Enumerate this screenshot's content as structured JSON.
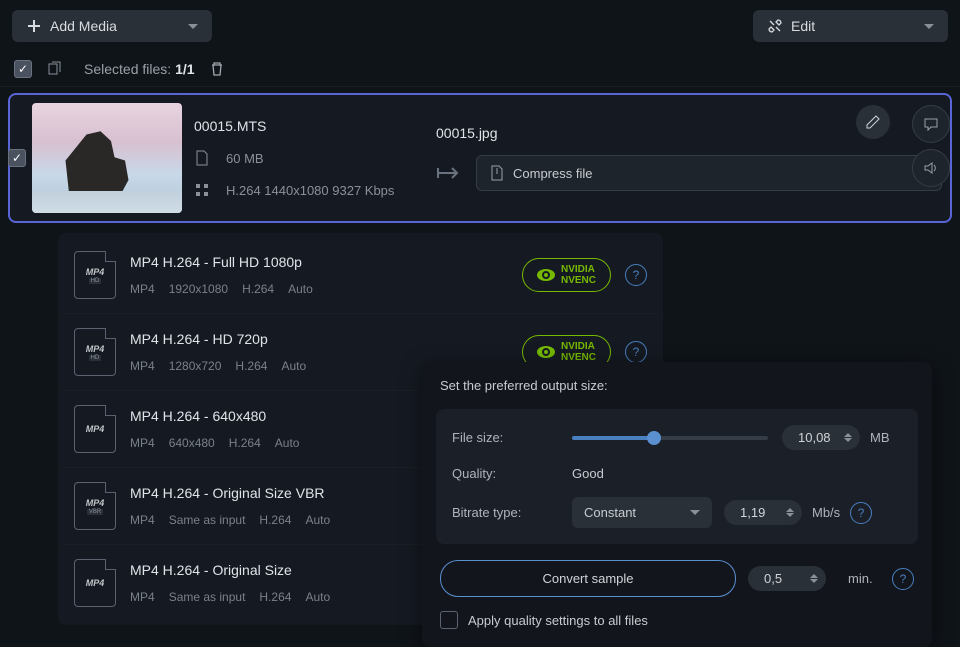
{
  "topbar": {
    "add_media_label": "Add Media",
    "edit_label": "Edit"
  },
  "selection": {
    "label_prefix": "Selected files:",
    "count": "1/1"
  },
  "file": {
    "source_name": "00015.MTS",
    "size": "60 MB",
    "specs": "H.264 1440x1080 9327 Kbps",
    "output_name": "00015.jpg",
    "compress_label": "Compress file"
  },
  "presets": [
    {
      "title": "MP4 H.264 - Full HD 1080p",
      "fmt": "MP4",
      "res": "1920x1080",
      "codec": "H.264",
      "rate": "Auto",
      "badge": true,
      "sub": "HD"
    },
    {
      "title": "MP4 H.264 - HD 720p",
      "fmt": "MP4",
      "res": "1280x720",
      "codec": "H.264",
      "rate": "Auto",
      "badge": true,
      "sub": "HD"
    },
    {
      "title": "MP4 H.264 - 640x480",
      "fmt": "MP4",
      "res": "640x480",
      "codec": "H.264",
      "rate": "Auto",
      "badge": false,
      "sub": ""
    },
    {
      "title": "MP4 H.264 - Original Size VBR",
      "fmt": "MP4",
      "res": "Same as input",
      "codec": "H.264",
      "rate": "Auto",
      "badge": false,
      "sub": "VBR"
    },
    {
      "title": "MP4 H.264 - Original Size",
      "fmt": "MP4",
      "res": "Same as input",
      "codec": "H.264",
      "rate": "Auto",
      "badge": false,
      "sub": ""
    }
  ],
  "nvidia": {
    "line1": "NVIDIA",
    "line2": "NVENC"
  },
  "panel": {
    "title": "Set the preferred output size:",
    "filesize_label": "File size:",
    "filesize_value": "10,08",
    "filesize_unit": "MB",
    "quality_label": "Quality:",
    "quality_value": "Good",
    "bitrate_label": "Bitrate type:",
    "bitrate_value": "Constant",
    "bitrate_num": "1,19",
    "bitrate_unit": "Mb/s",
    "convert_label": "Convert sample",
    "sample_len": "0,5",
    "sample_unit": "min.",
    "apply_label": "Apply quality settings to all files"
  }
}
